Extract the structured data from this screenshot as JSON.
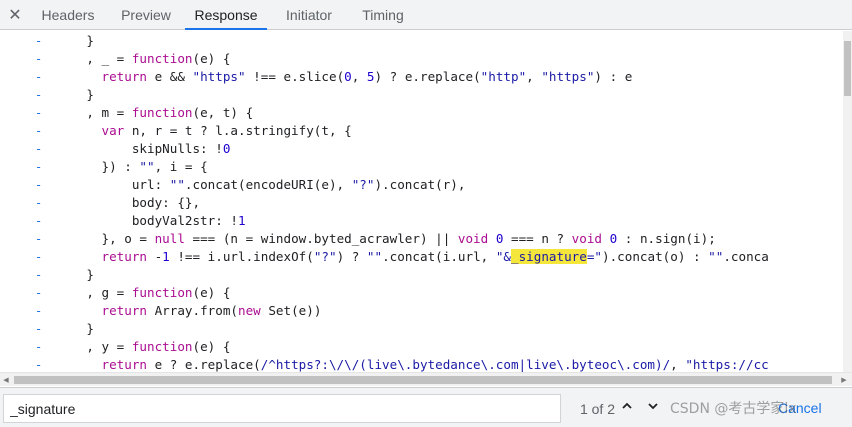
{
  "tabs": {
    "close_symbol": "✕",
    "items": [
      {
        "label": "Headers"
      },
      {
        "label": "Preview"
      },
      {
        "label": "Response"
      },
      {
        "label": "Initiator"
      },
      {
        "label": "Timing"
      }
    ],
    "active": "Response"
  },
  "gutter_marker": "-",
  "code": {
    "lines": [
      "    }",
      "    , _ = function(e) {",
      "      return e && \"https\" !== e.slice(0, 5) ? e.replace(\"http\", \"https\") : e",
      "    }",
      "    , m = function(e, t) {",
      "      var n, r = t ? l.a.stringify(t, {",
      "          skipNulls: !0",
      "      }) : \"\", i = {",
      "          url: \"\".concat(encodeURI(e), \"?\").concat(r),",
      "          body: {},",
      "          bodyVal2str: !1",
      "      }, o = null === (n = window.byted_acrawler) || void 0 === n ? void 0 : n.sign(i);",
      "      return -1 !== i.url.indexOf(\"?\") ? \"\".concat(i.url, \"&_signature=\").concat(o) : \"\".conca",
      "    }",
      "    , g = function(e) {",
      "      return Array.from(new Set(e))",
      "    }",
      "    , y = function(e) {",
      "      return e ? e.replace(/^https?:\\/\\/(live\\.bytedance\\.com|live\\.byteoc\\.com)/, \"https://cc"
    ],
    "highlight_term": "_signature"
  },
  "search": {
    "value": "_signature",
    "match_count": "1 of 2",
    "prev_symbol": "⌃",
    "next_symbol": "⌄",
    "cancel_label": "Cancel",
    "watermark": "CSDN @考古学家lx"
  }
}
